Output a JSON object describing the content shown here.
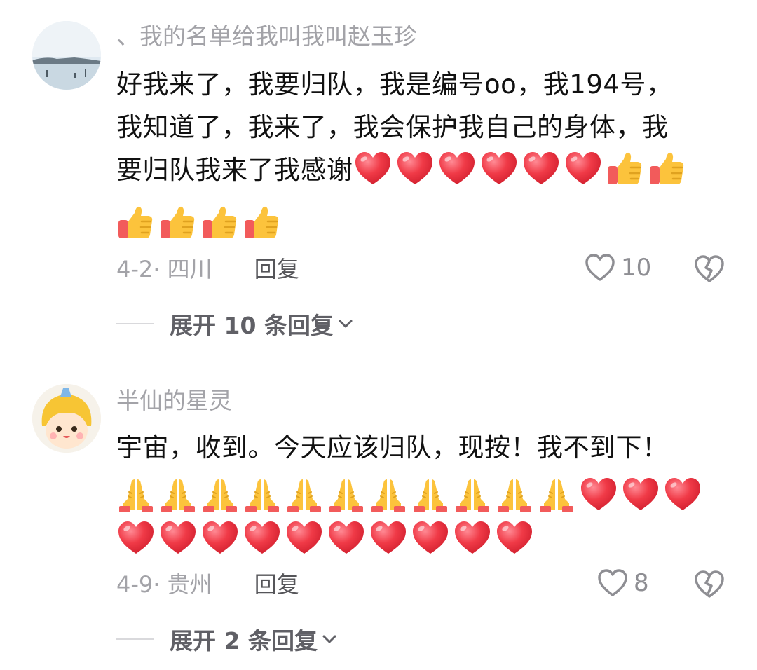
{
  "comments": [
    {
      "username": "、我的名单给我叫我叫赵玉珍",
      "text_lines": [
        "好我来了，我要归队，我是编号oo，我194号，",
        "我知道了，我来了，我会保护我自己的身体，我",
        "要归队我来了我感谢"
      ],
      "inline_emojis": [
        "heart",
        "heart",
        "heart",
        "heart",
        "heart",
        "heart",
        "thumbs-up",
        "thumbs-up"
      ],
      "row_emojis": [
        [
          "thumbs-up",
          "thumbs-up",
          "thumbs-up",
          "thumbs-up"
        ]
      ],
      "date": "4-2",
      "location": "四川",
      "reply_label": "回复",
      "likes": "10",
      "expand_label": "展开 10 条回复"
    },
    {
      "username": "半仙的星灵",
      "text_lines": [
        "宇宙，收到。今天应该归队，现按！我不到下！"
      ],
      "row_emojis": [
        [
          "pray",
          "pray",
          "pray",
          "pray",
          "pray",
          "pray",
          "pray",
          "pray",
          "pray",
          "pray",
          "pray",
          "heart",
          "heart",
          "heart"
        ],
        [
          "heart",
          "heart",
          "heart",
          "heart",
          "heart",
          "heart",
          "heart",
          "heart",
          "heart",
          "heart"
        ]
      ],
      "date": "4-9",
      "location": "贵州",
      "reply_label": "回复",
      "likes": "8",
      "expand_label": "展开 2 条回复"
    }
  ],
  "colors": {
    "secondary_text": "#a3a3a8",
    "primary_text": "#111111",
    "heart_red": "#f03a47",
    "thumbs_yellow": "#fcc33c"
  }
}
